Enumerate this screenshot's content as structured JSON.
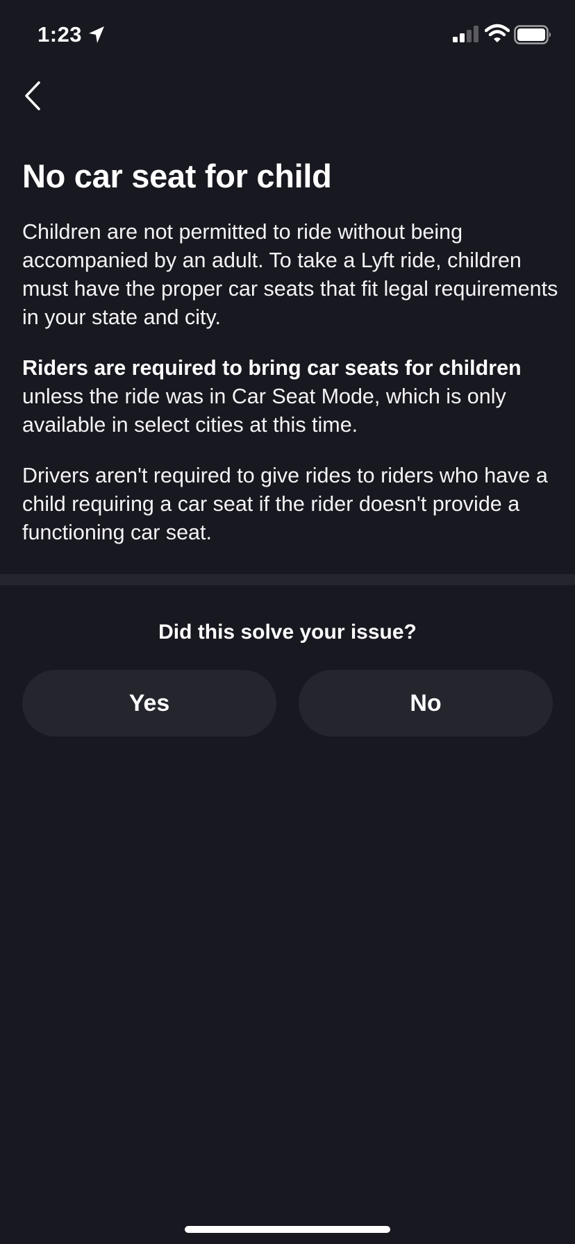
{
  "status_bar": {
    "time": "1:23"
  },
  "header": {
    "back_label": "Back"
  },
  "article": {
    "title": "No car seat for child",
    "paragraph_1": "Children are not permitted to ride without being accompanied by an adult. To take a Lyft ride, children must have the proper car seats that fit legal requirements in your state and city.",
    "paragraph_2_bold": "Riders are required to bring car seats for children",
    "paragraph_2_rest": " unless the ride was in Car Seat Mode, which is only available in select cities at this time.",
    "paragraph_3": "Drivers aren't required to give rides to riders who have a child requiring a car seat if the rider doesn't provide a functioning car seat."
  },
  "feedback": {
    "question": "Did this solve your issue?",
    "yes_label": "Yes",
    "no_label": "No"
  },
  "colors": {
    "background": "#181820",
    "button_background": "#24252d",
    "divider": "#24252d",
    "text": "#ffffff"
  },
  "icons": {
    "location": "location-arrow-icon",
    "signal": "cellular-signal-icon",
    "wifi": "wifi-icon",
    "battery": "battery-icon",
    "back": "chevron-left-icon"
  }
}
